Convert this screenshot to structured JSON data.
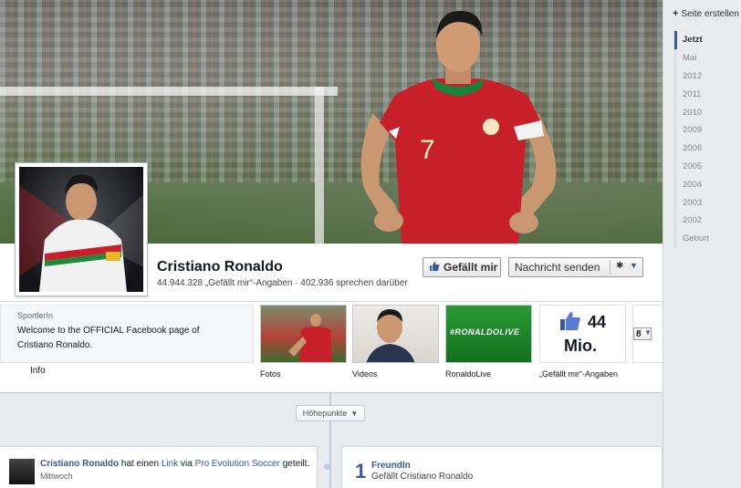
{
  "rail": {
    "create_page": "Seite erstellen",
    "years": [
      "Jetzt",
      "Mai",
      "2012",
      "2011",
      "2010",
      "2009",
      "2006",
      "2005",
      "2004",
      "2003",
      "2002",
      "Geburt"
    ],
    "active_year": "Jetzt"
  },
  "profile": {
    "name": "Cristiano Ronaldo",
    "stats": "44.944.328 „Gefällt mir“-Angaben · 402.936 sprechen darüber",
    "jersey_number": "7"
  },
  "buttons": {
    "like": "Gefällt mir",
    "message": "Nachricht senden"
  },
  "about": {
    "category": "SportlerIn",
    "description": "Welcome to the OFFICIAL Facebook page of Cristiano Ronaldo.",
    "info_label": "Info"
  },
  "tabs": [
    {
      "label": "Fotos"
    },
    {
      "label": "Videos"
    },
    {
      "label": "RonaldoLive",
      "logo_text": "#RONALDOLIVE"
    },
    {
      "label": "„Gefällt mir“-Angaben",
      "count": "44",
      "unit": "Mio."
    }
  ],
  "more_count": "8",
  "timeline": {
    "highlights": "Höhepunkte",
    "post": {
      "author": "Cristiano Ronaldo",
      "text_before": "hat einen",
      "link": "Link",
      "text_via": "via",
      "app": "Pro Evolution Soccer",
      "text_after": "geteilt.",
      "time": "Mittwoch"
    },
    "friends": {
      "count": "1",
      "label": "FreundIn",
      "sub": "Gefällt Cristiano Ronaldo"
    }
  },
  "colors": {
    "brand_blue": "#3b5998",
    "jersey_red": "#c8202b",
    "page_bg": "#e9ebee"
  }
}
